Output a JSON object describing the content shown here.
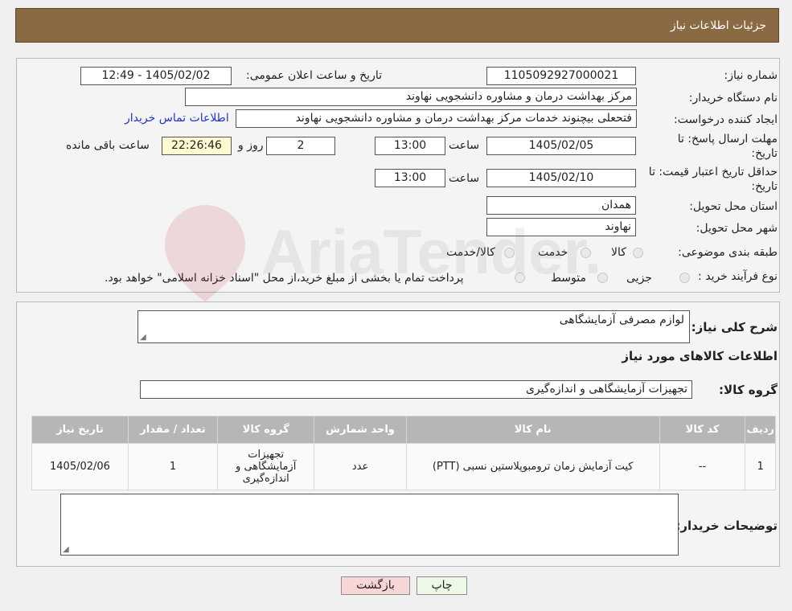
{
  "header": {
    "title": "جزئیات اطلاعات نیاز"
  },
  "form": {
    "need_number_label": "شماره نیاز:",
    "need_number": "1105092927000021",
    "announce_label": "تاریخ و ساعت اعلان عمومی:",
    "announce_value": "1405/02/02 - 12:49",
    "buyer_org_label": "نام دستگاه خریدار:",
    "buyer_org": "مرکز بهداشت  درمان و مشاوره دانشجویی نهاوند",
    "requester_label": "ایجاد کننده درخواست:",
    "requester": "فتحعلی بیچنوند خدمات مرکز بهداشت  درمان و مشاوره دانشجویی نهاوند",
    "buyer_contact_link": "اطلاعات تماس خریدار",
    "reply_deadline_label_1": "مهلت ارسال پاسخ: تا",
    "reply_deadline_label_2": "تاریخ:",
    "reply_date": "1405/02/05",
    "time_label": "ساعت",
    "reply_time": "13:00",
    "days_value": "2",
    "days_label": "روز و",
    "remaining_time": "22:26:46",
    "remaining_label": "ساعت باقی مانده",
    "validity_label_1": "حداقل تاریخ اعتبار قیمت: تا",
    "validity_label_2": "تاریخ:",
    "validity_date": "1405/02/10",
    "validity_time": "13:00",
    "province_label": "استان محل تحویل:",
    "province": "همدان",
    "city_label": "شهر محل تحویل:",
    "city": "نهاوند",
    "category_label": "طبقه بندی موضوعی:",
    "category_options": [
      "کالا",
      "خدمت",
      "کالا/خدمت"
    ],
    "process_label": "نوع فرآیند خرید :",
    "process_options": [
      "جزیی",
      "متوسط"
    ],
    "process_note": "پرداخت تمام یا بخشی از مبلغ خرید،از محل \"اسناد خزانه اسلامی\" خواهد بود."
  },
  "summary": {
    "description_label": "شرح کلی نیاز:",
    "description": "لوازم مصرفی آزمایشگاهی",
    "goods_info_title": "اطلاعات کالاهای مورد نیاز",
    "group_label": "گروه کالا:",
    "group_value": "تجهیزات آزمایشگاهی و اندازه‌گیری"
  },
  "table": {
    "headers": [
      "ردیف",
      "کد کالا",
      "نام کالا",
      "واحد شمارش",
      "گروه کالا",
      "تعداد / مقدار",
      "تاریخ نیاز"
    ],
    "rows": [
      [
        "1",
        "--",
        "کیت آزمایش زمان ترومبوپلاستین نسبی (PTT)",
        "عدد",
        "تجهیزات آزمایشگاهی و اندازه‌گیری",
        "1",
        "1405/02/06"
      ]
    ]
  },
  "buyer_notes_label": "توضیحات خریدار:",
  "buttons": {
    "print": "چاپ",
    "back": "بازگشت"
  },
  "watermark_text": "AriaTender.neT",
  "colors": {
    "header_bg": "#8a6a42",
    "link": "#1f35c9",
    "back_button_bg": "#f8d6d6",
    "print_button_bg": "#eef8e6"
  }
}
